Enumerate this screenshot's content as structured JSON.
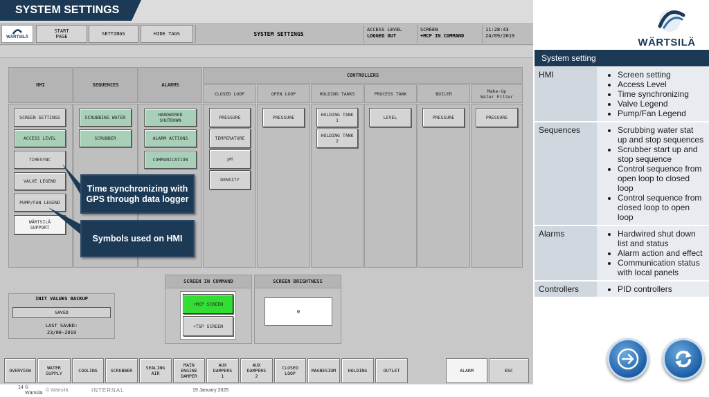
{
  "slide": {
    "title": "SYSTEM SETTINGS",
    "footer": {
      "page": "14",
      "copyright_small": "©\nWärtsilä",
      "copyright": "© Wärtsilä",
      "classification": "INTERNAL",
      "date": "19 January 2025"
    }
  },
  "brand": {
    "name": "WÄRTSILÄ",
    "hmi_logo": "WÄRTSILÄ",
    "color": "#1c3a56"
  },
  "hmi": {
    "toolbar": {
      "start_page": "START\nPAGE",
      "settings": "SETTINGS",
      "hide_tags": "HIDE TAGS",
      "screen_title": "SYSTEM SETTINGS",
      "access_level_label": "ACCESS LEVEL",
      "access_level_value": "LOGGED OUT",
      "screen_label": "SCREEN",
      "screen_value": "+MCP IN COMMAND",
      "time": "11:28:43",
      "date": "24/09/2019"
    },
    "headers": {
      "hmi": "HMI",
      "sequences": "SEQUENCES",
      "alarms": "ALARMS",
      "controllers": "CONTROLLERS",
      "closed_loop": "CLOSED LOOP",
      "open_loop": "OPEN LOOP",
      "holding_tanks": "HOLDING TANKS",
      "process_tank": "PROCESS TANK",
      "boiler": "BOILER",
      "makeup": "Make-Up\nWater Filter"
    },
    "hmi_buttons": [
      "SCREEN SETTINGS",
      "ACCESS LEVEL",
      "TIMESYNC",
      "VALVE LEGEND",
      "PUMP/FAN LEGEND",
      "WÄRTSILÄ\nSUPPORT"
    ],
    "sequence_buttons": [
      "SCRUBBING WATER",
      "SCRUBBER"
    ],
    "alarm_buttons": [
      "HARDWIRED\nSHUTDOWN",
      "ALARM ACTIONS",
      "COMMUNICATION"
    ],
    "closed_loop_buttons": [
      "PRESSURE",
      "TEMPERATURE",
      "pH",
      "DENSITY"
    ],
    "open_loop_buttons": [
      "PRESSURE"
    ],
    "holding_buttons": [
      "HOLDING TANK\n1",
      "HOLDING TANK\n2"
    ],
    "process_buttons": [
      "LEVEL"
    ],
    "boiler_buttons": [
      "PRESSURE"
    ],
    "makeup_buttons": [
      "PRESSURE"
    ],
    "callouts": {
      "timesync": "Time synchronizing with GPS through data logger",
      "symbols": "Symbols used on HMI"
    },
    "init_backup": {
      "title": "INIT VALUES BACKUP",
      "button": "SAVED",
      "last_saved_label": "LAST SAVED:",
      "last_saved_date": "23/08-2019"
    },
    "screen_in_command": {
      "title": "SCREEN IN COMMAND",
      "mcp": "+MCP SCREEN",
      "tsp": "+TSP SCREEN"
    },
    "brightness": {
      "title": "SCREEN BRIGHTNESS",
      "value": "0"
    },
    "nav": [
      "OVERVIEW",
      "WATER\nSUPPLY",
      "COOLING",
      "SCRUBBER",
      "SEALING\nAIR",
      "MAIN\nENGINE\nDAMPER",
      "AUX\nDAMPERS\n1",
      "AUX\nDAMPERS\n2",
      "CLOSED\nLOOP",
      "MAGNESIUM",
      "HOLDING",
      "OUTLET",
      "ALARM",
      "ESC"
    ]
  },
  "info": {
    "title": "System setting",
    "rows": [
      {
        "category": "HMI",
        "items": [
          "Screen setting",
          "Access Level",
          "Time synchronizing",
          "Valve Legend",
          "Pump/Fan Legend"
        ]
      },
      {
        "category": "Sequences",
        "items": [
          "Scrubbing water stat up and stop sequences",
          "Scrubber start up and stop sequence",
          "Control sequence from open loop to closed loop",
          "Control sequence from closed loop to open loop"
        ]
      },
      {
        "category": "Alarms",
        "items": [
          "Hardwired shut down list and status",
          "Alarm action and effect",
          "Communication status with local panels"
        ]
      },
      {
        "category": "Controllers",
        "items": [
          "PID controllers"
        ]
      }
    ]
  },
  "icons": {
    "next": "arrow-right-circle-icon",
    "refresh": "refresh-icon"
  }
}
